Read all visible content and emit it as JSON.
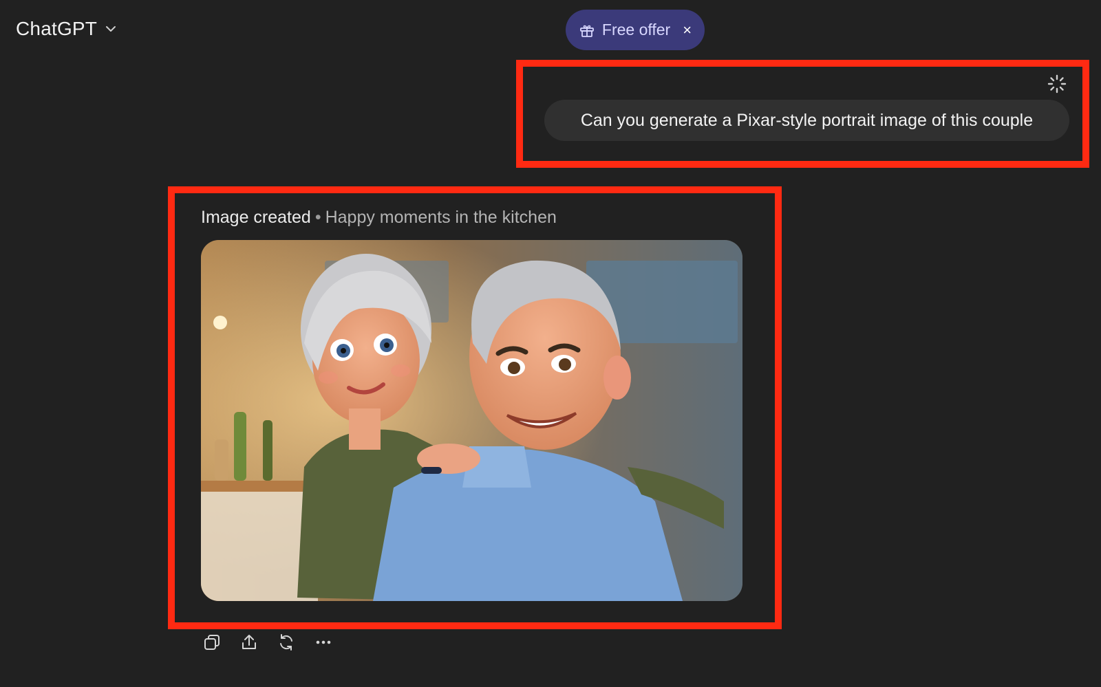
{
  "header": {
    "model_name": "ChatGPT",
    "offer_label": "Free offer",
    "offer_close": "×"
  },
  "conversation": {
    "user_message": "Can you generate a Pixar-style portrait image of this couple",
    "assistant": {
      "status": "Image created",
      "separator": "•",
      "caption": "Happy moments in the kitchen"
    }
  },
  "actions": [
    "copy-icon",
    "share-icon",
    "regenerate-icon",
    "more-icon"
  ],
  "colors": {
    "background": "#212121",
    "highlight": "#ff2a12",
    "offer_pill": "#3b3a7a",
    "user_bubble": "#303030"
  }
}
